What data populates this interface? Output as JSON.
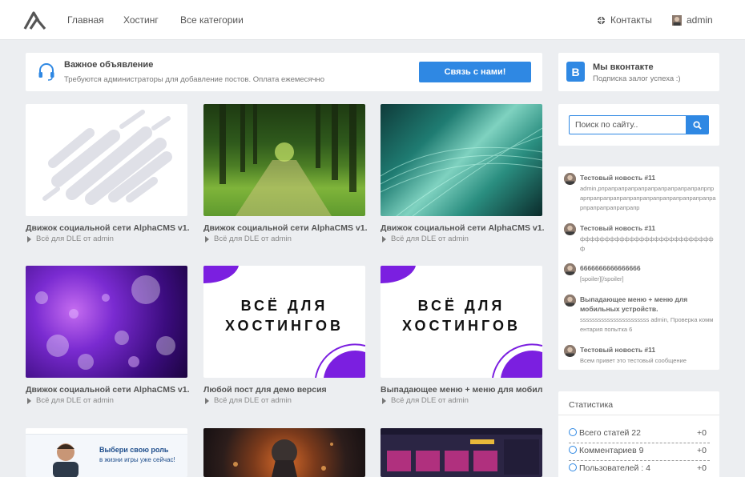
{
  "nav": {
    "home": "Главная",
    "hosting": "Хостинг",
    "categories": "Все категории",
    "contacts": "Контакты",
    "user": "admin"
  },
  "announcement": {
    "title": "Важное объявление",
    "text": "Требуются администраторы для добавление постов. Оплата ежемесячно",
    "button": "Связь с нами!"
  },
  "vk": {
    "badge": "В",
    "title": "Мы вконтакте",
    "subtitle": "Подписка залог успеха :)"
  },
  "search": {
    "placeholder": "Поиск по сайту.."
  },
  "posts": [
    {
      "title": "Движок социальной сети AlphaCMS v1.",
      "meta": "Всё для DLE от admin",
      "image": "placeholder-shapes"
    },
    {
      "title": "Движок социальной сети AlphaCMS v1.",
      "meta": "Всё для DLE от admin",
      "image": "forest-path"
    },
    {
      "title": "Движок социальной сети AlphaCMS v1.",
      "meta": "Всё для DLE от admin",
      "image": "teal-abstract"
    },
    {
      "title": "Движок социальной сети AlphaCMS v1.",
      "meta": "Всё для DLE от admin",
      "image": "purple-bokeh"
    },
    {
      "title": "Любой пост для демо версия",
      "meta": "Всё для DLE от admin",
      "image": "brand-banner",
      "banner_line1": "ВСЁ ДЛЯ",
      "banner_line2": "ХОСТИНГОВ"
    },
    {
      "title": "Выпадающее меню + меню для мобил",
      "meta": "Всё для DLE от admin",
      "image": "brand-banner",
      "banner_line1": "ВСЁ ДЛЯ",
      "banner_line2": "ХОСТИНГОВ"
    },
    {
      "image": "landing-screenshot",
      "caption_line1": "Выбери свою роль",
      "caption_line2": "в жизни игры уже сейчас!"
    },
    {
      "image": "game-art"
    },
    {
      "image": "ui-screenshot"
    }
  ],
  "comments": [
    {
      "title": "Тестовый новость #11",
      "body": "admin,рпрапрапрапрапрапрапрапрапрапрапрпрарпрапрапрапрапрапрапрапрапрапрапрапрапрарпрапрапрапрапрапр"
    },
    {
      "title": "Тестовый новость #11",
      "body": "фффффффффффффффффффффффффффф"
    },
    {
      "title": "6666666666666666",
      "body": "[spoiler][/spoiler]"
    },
    {
      "title": "Выпадающее меню + меню для мобильных устройств.",
      "body": "sssssssssssssssssssssss admin, Проверка комментария попытка 6"
    },
    {
      "title": "Тестовый новость #11",
      "body": "Всем привет это тестовый сообщение"
    }
  ],
  "stats": {
    "title": "Статистика",
    "rows": [
      {
        "label": "Всего статей 22",
        "delta": "+0"
      },
      {
        "label": "Комментариев 9",
        "delta": "+0"
      },
      {
        "label": "Пользователей : 4",
        "delta": "+0"
      }
    ]
  },
  "colors": {
    "accent": "#2f88e3",
    "background": "#eceef1",
    "brand_purple": "#7b1fe0"
  }
}
